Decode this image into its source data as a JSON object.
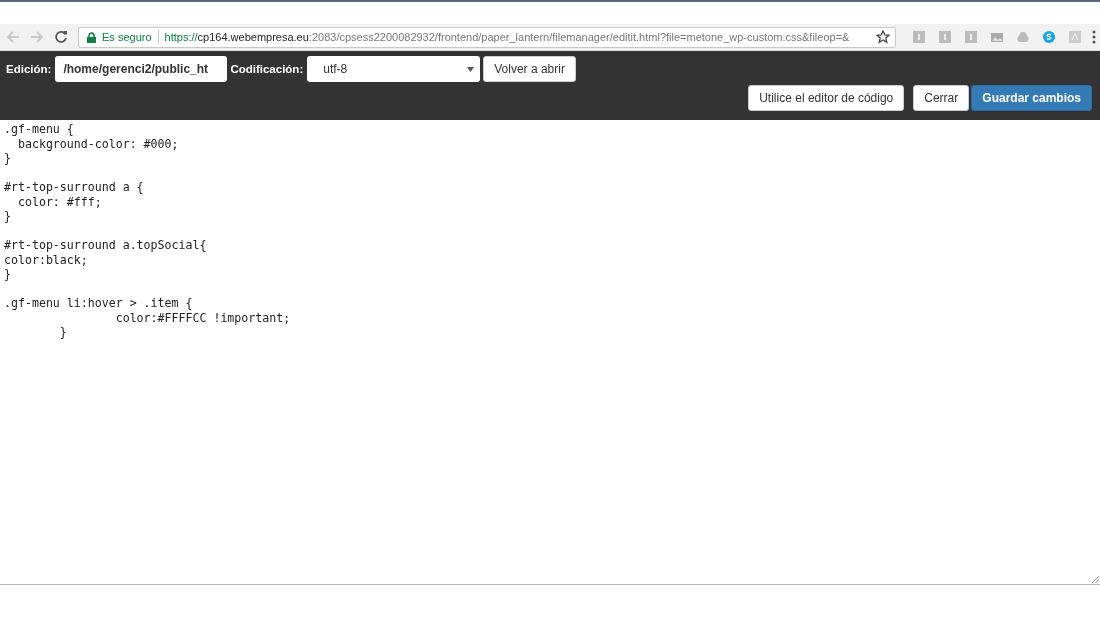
{
  "browser": {
    "security_label": "Es seguro",
    "url": {
      "scheme": "https://",
      "host": "cp164.webempresa.eu",
      "path": ":2083/cpsess2200082932/frontend/paper_lantern/filemanager/editit.html?file=metone_wp-custom.css&fileop=&"
    },
    "extensions": [
      {
        "kind": "letter"
      },
      {
        "kind": "letter"
      },
      {
        "kind": "letter"
      },
      {
        "kind": "photo"
      },
      {
        "kind": "drive"
      },
      {
        "kind": "skype"
      },
      {
        "kind": "pdf"
      }
    ]
  },
  "toolbar": {
    "edit_label": "Edición:",
    "path_value": "/home/gerenci2/public_ht",
    "encoding_label": "Codificación:",
    "encoding_value": "utf-8",
    "reopen_button": "Volver a abrir"
  },
  "actions": [
    {
      "label": "Utilice el editor de código",
      "primary": false
    },
    {
      "label": "Cerrar",
      "primary": false
    },
    {
      "label": "Guardar cambios",
      "primary": true
    }
  ],
  "code_blocks": [
    [
      ".gf-menu {",
      "  background-color: #000;",
      "}"
    ],
    [
      "#rt-top-surround a {",
      "  color: #fff;",
      "}"
    ],
    [
      "#rt-top-surround a.topSocial{",
      "color:black;",
      "}"
    ],
    [
      ".gf-menu li:hover > .item {",
      "                color:#FFFFCC !important;",
      "        }"
    ]
  ]
}
